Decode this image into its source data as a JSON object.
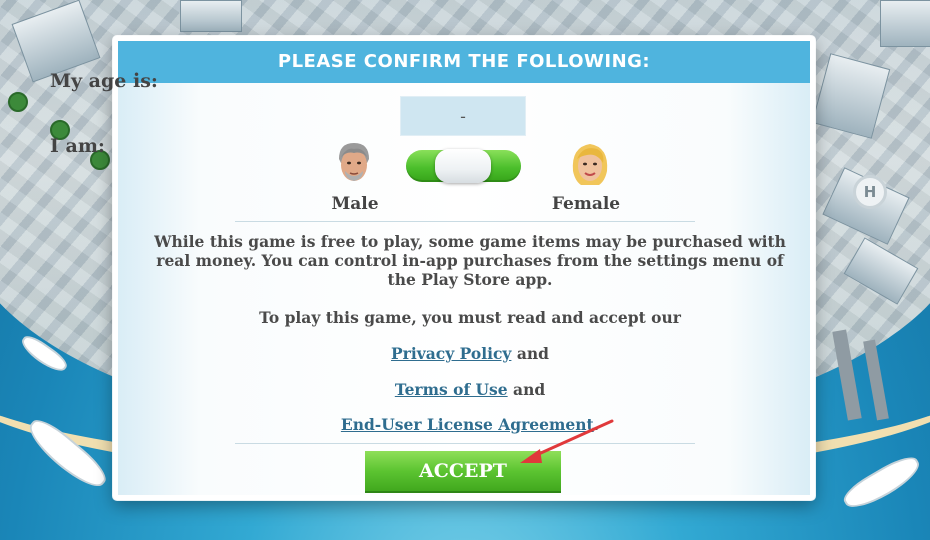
{
  "dialog": {
    "title": "PLEASE CONFIRM THE FOLLOWING:",
    "age_label": "My age is:",
    "age_value": "-",
    "gender_label": "I am:",
    "male_label": "Male",
    "female_label": "Female",
    "toggle_state": "center",
    "disclaimer": "While this game is free to play, some game items may be purchased with real money. You can control in-app purchases from the settings menu of the Play Store app.",
    "consent_intro": "To play this game, you must read and accept our",
    "privacy_link": "Privacy Policy",
    "terms_link": "Terms of Use",
    "eula_link": "End-User License Agreement",
    "and_word_1": " and",
    "and_word_2": " and",
    "period": ".",
    "accept_label": "ACCEPT"
  },
  "colors": {
    "header_bg": "#4fb4de",
    "accept_green": "#5cc431",
    "link_color": "#2f6d8f",
    "annotation_arrow": "#e0393b"
  },
  "icons": {
    "male_avatar": "male-avatar-icon",
    "female_avatar": "female-avatar-icon",
    "helipad": "helipad-icon"
  },
  "background": {
    "helipad_letter": "H"
  }
}
